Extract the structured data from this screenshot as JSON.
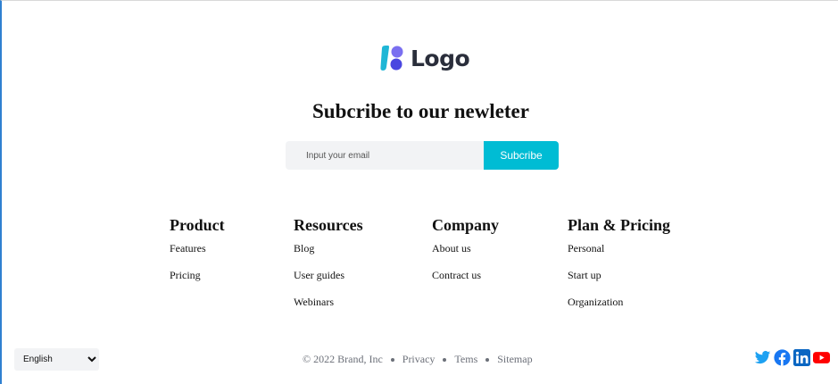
{
  "logo": {
    "text": "Logo"
  },
  "newsletter": {
    "title": "Subcribe to our newleter",
    "email_placeholder": "Input your email",
    "subscribe_label": "Subcribe"
  },
  "columns": [
    {
      "heading": "Product",
      "links": [
        "Features",
        "Pricing"
      ]
    },
    {
      "heading": "Resources",
      "links": [
        "Blog",
        "User guides",
        "Webinars"
      ]
    },
    {
      "heading": "Company",
      "links": [
        "About us",
        "Contract us"
      ]
    },
    {
      "heading": "Plan & Pricing",
      "links": [
        "Personal",
        "Start up",
        "Organization"
      ]
    }
  ],
  "footer": {
    "language_selected": "English",
    "copyright": "© 2022 Brand, Inc",
    "links": [
      "Privacy",
      "Tems",
      "Sitemap"
    ]
  },
  "social": [
    "twitter-icon",
    "facebook-icon",
    "linkedin-icon",
    "youtube-icon"
  ],
  "colors": {
    "accent": "#00bcd4",
    "logo_teal": "#1fb6d6",
    "logo_purple": "#5b4ee8",
    "twitter": "#1da1f2",
    "facebook": "#1877f2",
    "linkedin": "#0a66c2",
    "youtube": "#ff0000"
  }
}
